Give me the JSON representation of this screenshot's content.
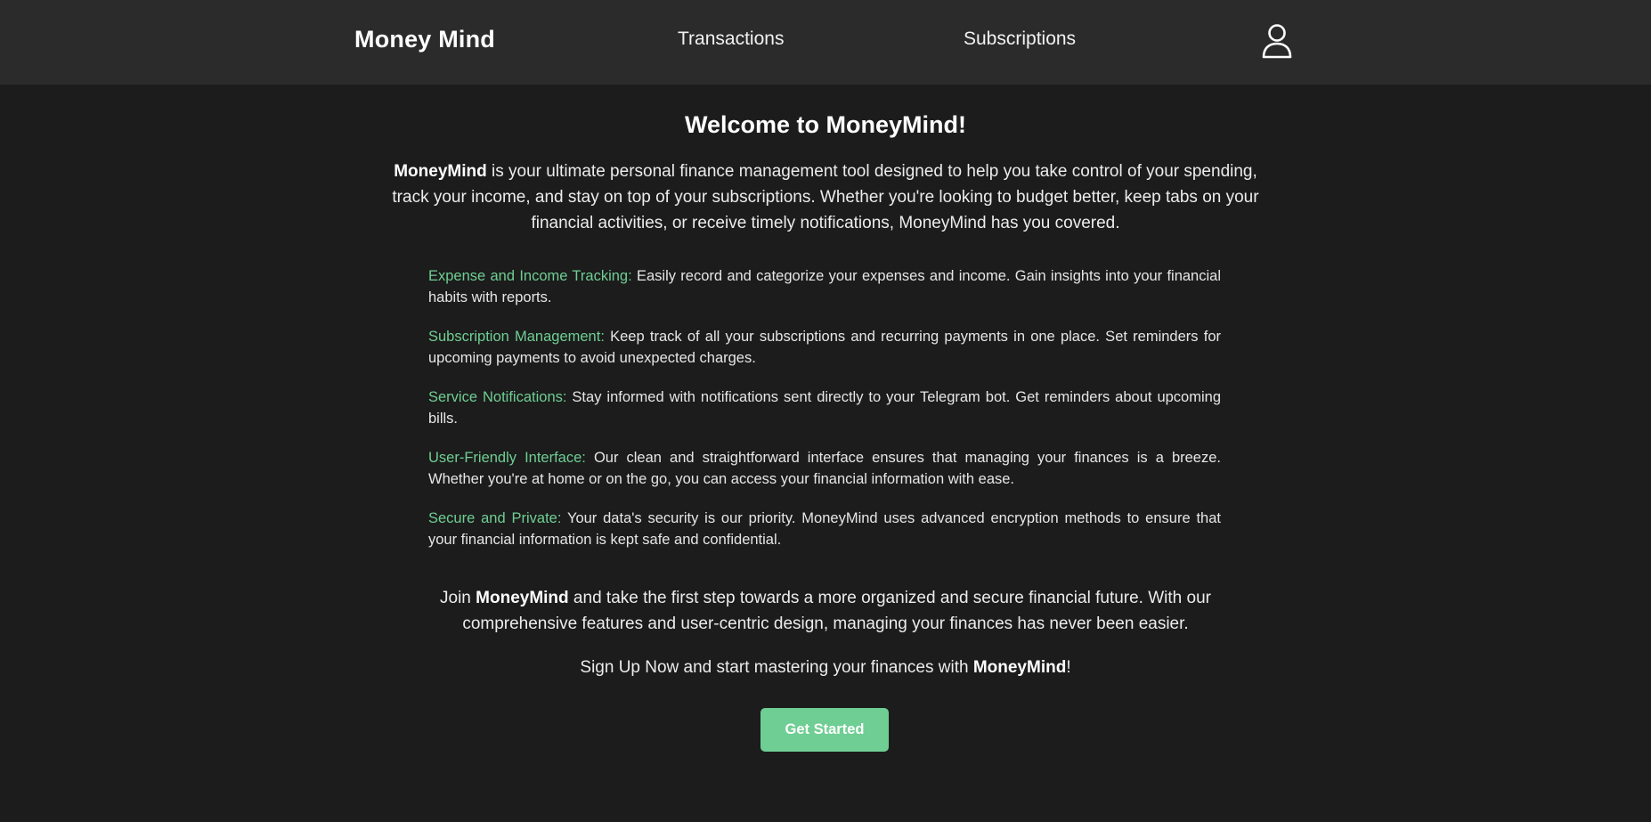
{
  "colors": {
    "accent": "#6fce93",
    "navbar_bg": "#2b2b2b",
    "page_bg": "#1c1c1c"
  },
  "navbar": {
    "brand": "Money Mind",
    "links": [
      "Transactions",
      "Subscriptions"
    ],
    "profile_icon": "user-icon"
  },
  "main": {
    "title": "Welcome to MoneyMind!",
    "intro": {
      "brand": "MoneyMind",
      "text": " is your ultimate personal finance management tool designed to help you take control of your spending, track your income, and stay on top of your subscriptions. Whether you're looking to budget better, keep tabs on your financial activities, or receive timely notifications, MoneyMind has you covered."
    },
    "features": [
      {
        "title": "Expense and Income Tracking:",
        "text": " Easily record and categorize your expenses and income. Gain insights into your financial habits with reports."
      },
      {
        "title": "Subscription Management:",
        "text": " Keep track of all your subscriptions and recurring payments in one place. Set reminders for upcoming payments to avoid unexpected charges."
      },
      {
        "title": "Service Notifications:",
        "text": " Stay informed with notifications sent directly to your Telegram bot. Get reminders about upcoming bills."
      },
      {
        "title": "User-Friendly Interface:",
        "text": " Our clean and straightforward interface ensures that managing your finances is a breeze. Whether you're at home or on the go, you can access your financial information with ease."
      },
      {
        "title": "Secure and Private:",
        "text": " Your data's security is our priority. MoneyMind uses advanced encryption methods to ensure that your financial information is kept safe and confidential."
      }
    ],
    "outro": {
      "prefix": "Join ",
      "brand": "MoneyMind",
      "text": " and take the first step towards a more organized and secure financial future. With our comprehensive features and user-centric design, managing your finances has never been easier."
    },
    "signup": {
      "prefix": "Sign Up Now and start mastering your finances with ",
      "brand": "MoneyMind",
      "suffix": "!"
    },
    "cta_label": "Get Started"
  }
}
